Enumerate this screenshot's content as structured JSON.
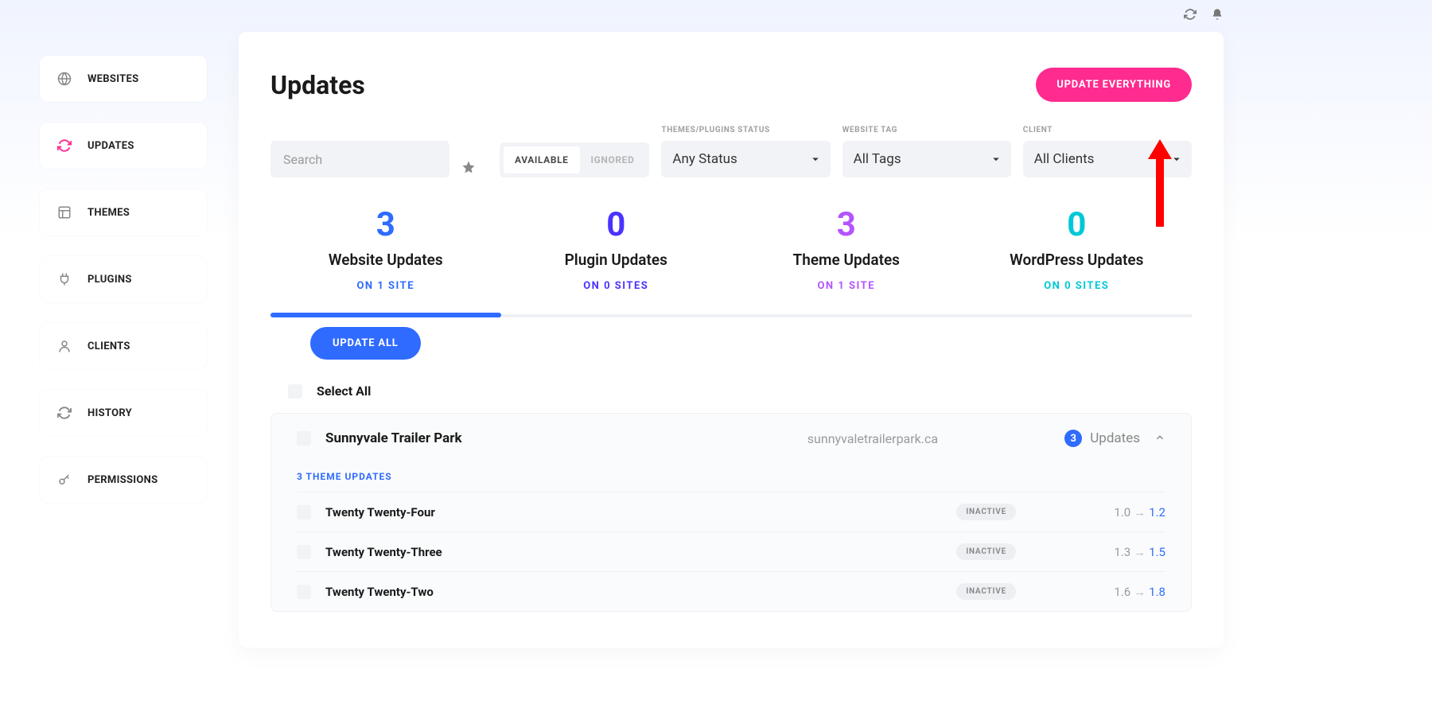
{
  "sidebar": {
    "items": [
      {
        "label": "WEBSITES",
        "icon": "globe"
      },
      {
        "label": "UPDATES",
        "icon": "refresh",
        "active": true
      },
      {
        "label": "THEMES",
        "icon": "layout"
      },
      {
        "label": "PLUGINS",
        "icon": "plug"
      },
      {
        "label": "CLIENTS",
        "icon": "person"
      },
      {
        "label": "HISTORY",
        "icon": "refresh"
      },
      {
        "label": "PERMISSIONS",
        "icon": "key"
      }
    ]
  },
  "header": {
    "title": "Updates",
    "cta": "UPDATE EVERYTHING"
  },
  "filters": {
    "search_placeholder": "Search",
    "segments": {
      "available": "AVAILABLE",
      "ignored": "IGNORED"
    },
    "status": {
      "label": "THEMES/PLUGINS STATUS",
      "selected": "Any Status"
    },
    "tag": {
      "label": "WEBSITE TAG",
      "selected": "All Tags"
    },
    "client": {
      "label": "CLIENT",
      "selected": "All Clients"
    }
  },
  "stats": [
    {
      "count": "3",
      "label": "Website Updates",
      "sub": "ON 1 SITE",
      "color": "c-blue",
      "active": true
    },
    {
      "count": "0",
      "label": "Plugin Updates",
      "sub": "ON 0 SITES",
      "color": "c-indigo"
    },
    {
      "count": "3",
      "label": "Theme Updates",
      "sub": "ON 1 SITE",
      "color": "c-purple"
    },
    {
      "count": "0",
      "label": "WordPress Updates",
      "sub": "ON 0 SITES",
      "color": "c-teal"
    }
  ],
  "actions": {
    "update_all": "UPDATE ALL",
    "select_all": "Select All"
  },
  "site": {
    "name": "Sunnyvale Trailer Park",
    "url": "sunnyvaletrailerpark.ca",
    "update_count": "3",
    "updates_label": "Updates",
    "sub_heading": "3 THEME UPDATES",
    "items": [
      {
        "name": "Twenty Twenty-Four",
        "status": "INACTIVE",
        "from": "1.0",
        "to": "1.2"
      },
      {
        "name": "Twenty Twenty-Three",
        "status": "INACTIVE",
        "from": "1.3",
        "to": "1.5"
      },
      {
        "name": "Twenty Twenty-Two",
        "status": "INACTIVE",
        "from": "1.6",
        "to": "1.8"
      }
    ]
  }
}
